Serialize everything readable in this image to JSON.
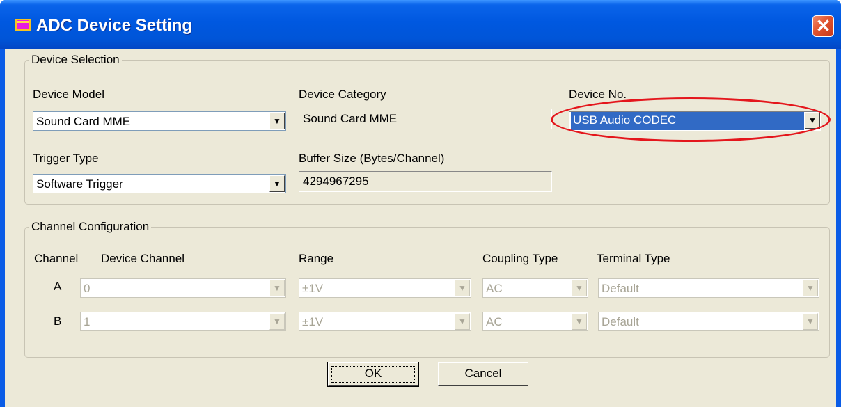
{
  "window": {
    "title": "ADC Device Setting",
    "close_label": "✕"
  },
  "device_selection": {
    "legend": "Device Selection",
    "device_model": {
      "label": "Device Model",
      "value": "Sound Card MME"
    },
    "device_category": {
      "label": "Device Category",
      "value": "Sound Card MME"
    },
    "device_no": {
      "label": "Device No.",
      "value": "USB Audio CODEC"
    },
    "trigger_type": {
      "label": "Trigger Type",
      "value": "Software Trigger"
    },
    "buffer_size": {
      "label": "Buffer Size (Bytes/Channel)",
      "value": "4294967295"
    }
  },
  "channel_config": {
    "legend": "Channel Configuration",
    "headers": {
      "channel": "Channel",
      "device_channel": "Device Channel",
      "range": "Range",
      "coupling": "Coupling Type",
      "terminal": "Terminal Type"
    },
    "rows": [
      {
        "channel": "A",
        "device_channel": "0",
        "range": "±1V",
        "coupling": "AC",
        "terminal": "Default"
      },
      {
        "channel": "B",
        "device_channel": "1",
        "range": "±1V",
        "coupling": "AC",
        "terminal": "Default"
      }
    ]
  },
  "buttons": {
    "ok": "OK",
    "cancel": "Cancel"
  },
  "colors": {
    "titlebar": "#0058e0",
    "dialog_bg": "#ece9d8",
    "selection": "#316ac5",
    "annotation": "#e4161c"
  },
  "icons": {
    "app": "app-window-icon",
    "close": "close-icon",
    "dropdown": "dropdown-arrow-icon"
  }
}
